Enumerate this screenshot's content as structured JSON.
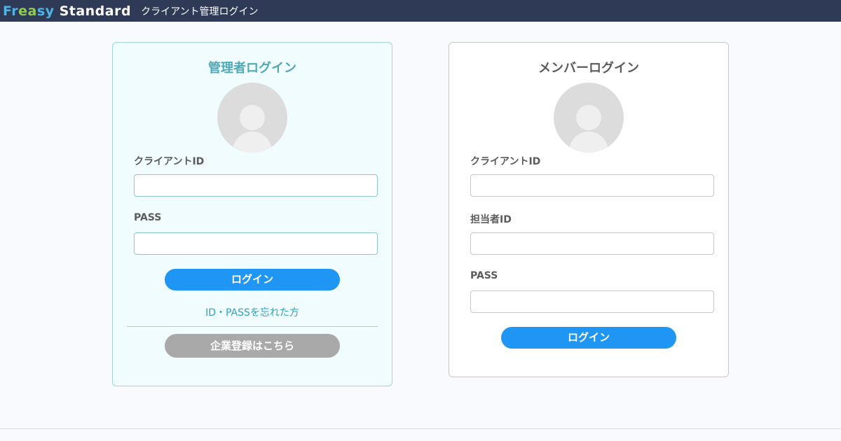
{
  "header": {
    "logo": {
      "part1": "Fr",
      "part2": "ea",
      "part3": "sy",
      "part4": "Standard"
    },
    "title": "クライアント管理ログイン"
  },
  "admin_login": {
    "title": "管理者ログイン",
    "client_id_label": "クライアントID",
    "client_id_value": "",
    "pass_label": "PASS",
    "pass_value": "",
    "login_button": "ログイン",
    "forgot_link": "ID・PASSを忘れた方",
    "register_button": "企業登録はこちら"
  },
  "member_login": {
    "title": "メンバーログイン",
    "client_id_label": "クライアントID",
    "client_id_value": "",
    "member_id_label": "担当者ID",
    "member_id_value": "",
    "pass_label": "PASS",
    "pass_value": "",
    "login_button": "ログイン"
  },
  "colors": {
    "header_bg": "#2f3a56",
    "admin_accent": "#4fa9b8",
    "login_button": "#1f96f3",
    "register_button": "#a9a9a9"
  },
  "icons": {
    "avatar": "user-silhouette-icon"
  }
}
